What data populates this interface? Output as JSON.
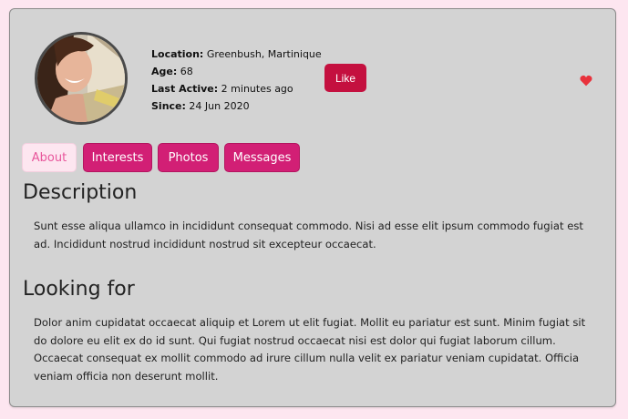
{
  "profile": {
    "location_label": "Location:",
    "location": "Greenbush, Martinique",
    "age_label": "Age:",
    "age": "68",
    "last_active_label": "Last Active:",
    "last_active": "2 minutes ago",
    "since_label": "Since:",
    "since": "24 Jun 2020"
  },
  "actions": {
    "like_label": "Like",
    "heart_icon": "heart-icon"
  },
  "tabs": [
    {
      "label": "About",
      "active": true
    },
    {
      "label": "Interests",
      "active": false
    },
    {
      "label": "Photos",
      "active": false
    },
    {
      "label": "Messages",
      "active": false
    }
  ],
  "description": {
    "title": "Description",
    "text": "Sunt esse aliqua ullamco in incididunt consequat commodo. Nisi ad esse elit ipsum commodo fugiat est ad. Incididunt nostrud incididunt nostrud sit excepteur occaecat."
  },
  "looking_for": {
    "title": "Looking for",
    "text": "Dolor anim cupidatat occaecat aliquip et Lorem ut elit fugiat. Mollit eu pariatur est sunt. Minim fugiat sit do dolore eu elit ex do id sunt. Qui fugiat nostrud occaecat nisi est dolor qui fugiat laborum cillum. Occaecat consequat ex mollit commodo ad irure cillum nulla velit ex pariatur veniam cupidatat. Officia veniam officia non deserunt mollit."
  },
  "colors": {
    "page_bg": "#fde6f0",
    "card_bg": "#d3d3d3",
    "accent": "#d21f75",
    "like": "#c4103f",
    "heart": "#e8323c"
  }
}
